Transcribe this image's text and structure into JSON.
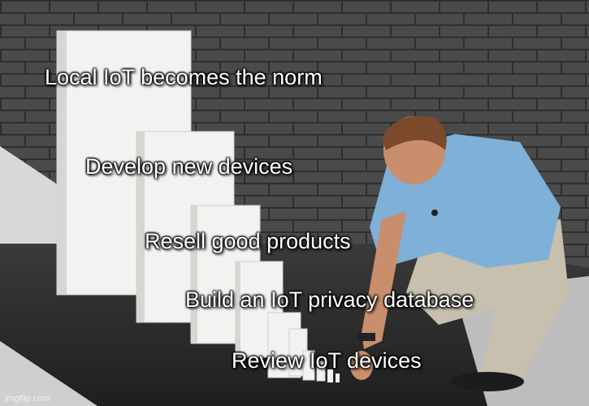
{
  "captions": [
    "Local IoT becomes the norm",
    "Develop new devices",
    "Resell good products",
    "Build an IoT privacy database",
    "Review IoT devices"
  ],
  "watermark": "imgflip.com",
  "colors": {
    "brick_wall": "#4a4a4a",
    "mortar": "#2e2e2e",
    "floor_light": "#d9d9d9",
    "floor_dark": "#2b2b2b",
    "domino": "#f2f2f0",
    "shirt": "#7fb0d8",
    "pants": "#c8c0ae",
    "skin": "#c98e6c",
    "hair": "#7a4a2a",
    "caption_text": "#ffffff"
  }
}
